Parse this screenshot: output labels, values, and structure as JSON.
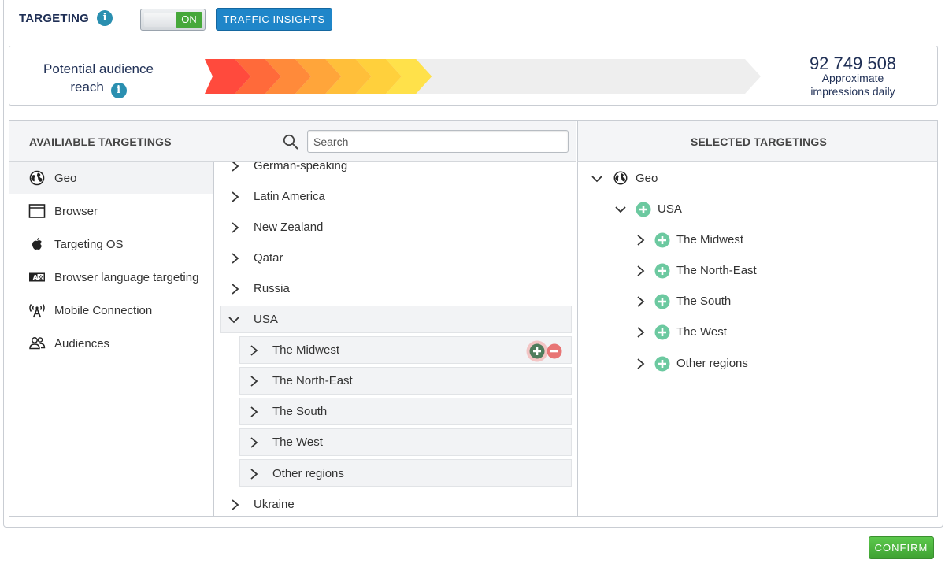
{
  "header": {
    "title": "TARGETING",
    "toggle_label": "ON",
    "traffic_button": "TRAFFIC INSIGHTS"
  },
  "audience": {
    "label": "Potential audience reach",
    "value": "92 749 508",
    "sub": "Approximate impressions daily",
    "reach_fraction": 0.38,
    "bar_colors": [
      "#ff4a3d",
      "#ff6a3a",
      "#ff8a3a",
      "#ffa53a",
      "#ffbf3a",
      "#ffd03c",
      "#ffe14a"
    ]
  },
  "left_panel": {
    "title": "AVAILIABLE TARGETINGS",
    "search_placeholder": "Search",
    "categories": [
      {
        "label": "Geo",
        "icon": "globe-icon",
        "active": true
      },
      {
        "label": "Browser",
        "icon": "browser-window-icon"
      },
      {
        "label": "Targeting OS",
        "icon": "apple-icon"
      },
      {
        "label": "Browser language targeting",
        "icon": "language-icon"
      },
      {
        "label": "Mobile Connection",
        "icon": "antenna-icon"
      },
      {
        "label": "Audiences",
        "icon": "users-icon"
      }
    ],
    "tree": {
      "partial_top": "German-speaking",
      "items_before": [
        "Latin America",
        "New Zealand",
        "Qatar",
        "Russia"
      ],
      "expanded": "USA",
      "children": [
        "The Midwest",
        "The North-East",
        "The South",
        "The West",
        "Other regions"
      ],
      "items_after": [
        "Ukraine"
      ]
    }
  },
  "right_panel": {
    "title": "SELECTED TARGETINGS",
    "root": "Geo",
    "country": "USA",
    "children": [
      "The Midwest",
      "The North-East",
      "The South",
      "The West",
      "Other regions"
    ]
  },
  "footer": {
    "confirm": "CONFIRM"
  },
  "colors": {
    "brand_blue": "#1f86c9",
    "confirm_green": "#4cb63f",
    "add_green": "#6cc9a0",
    "remove_red": "#e87575",
    "navy_text": "#1f2f55"
  }
}
